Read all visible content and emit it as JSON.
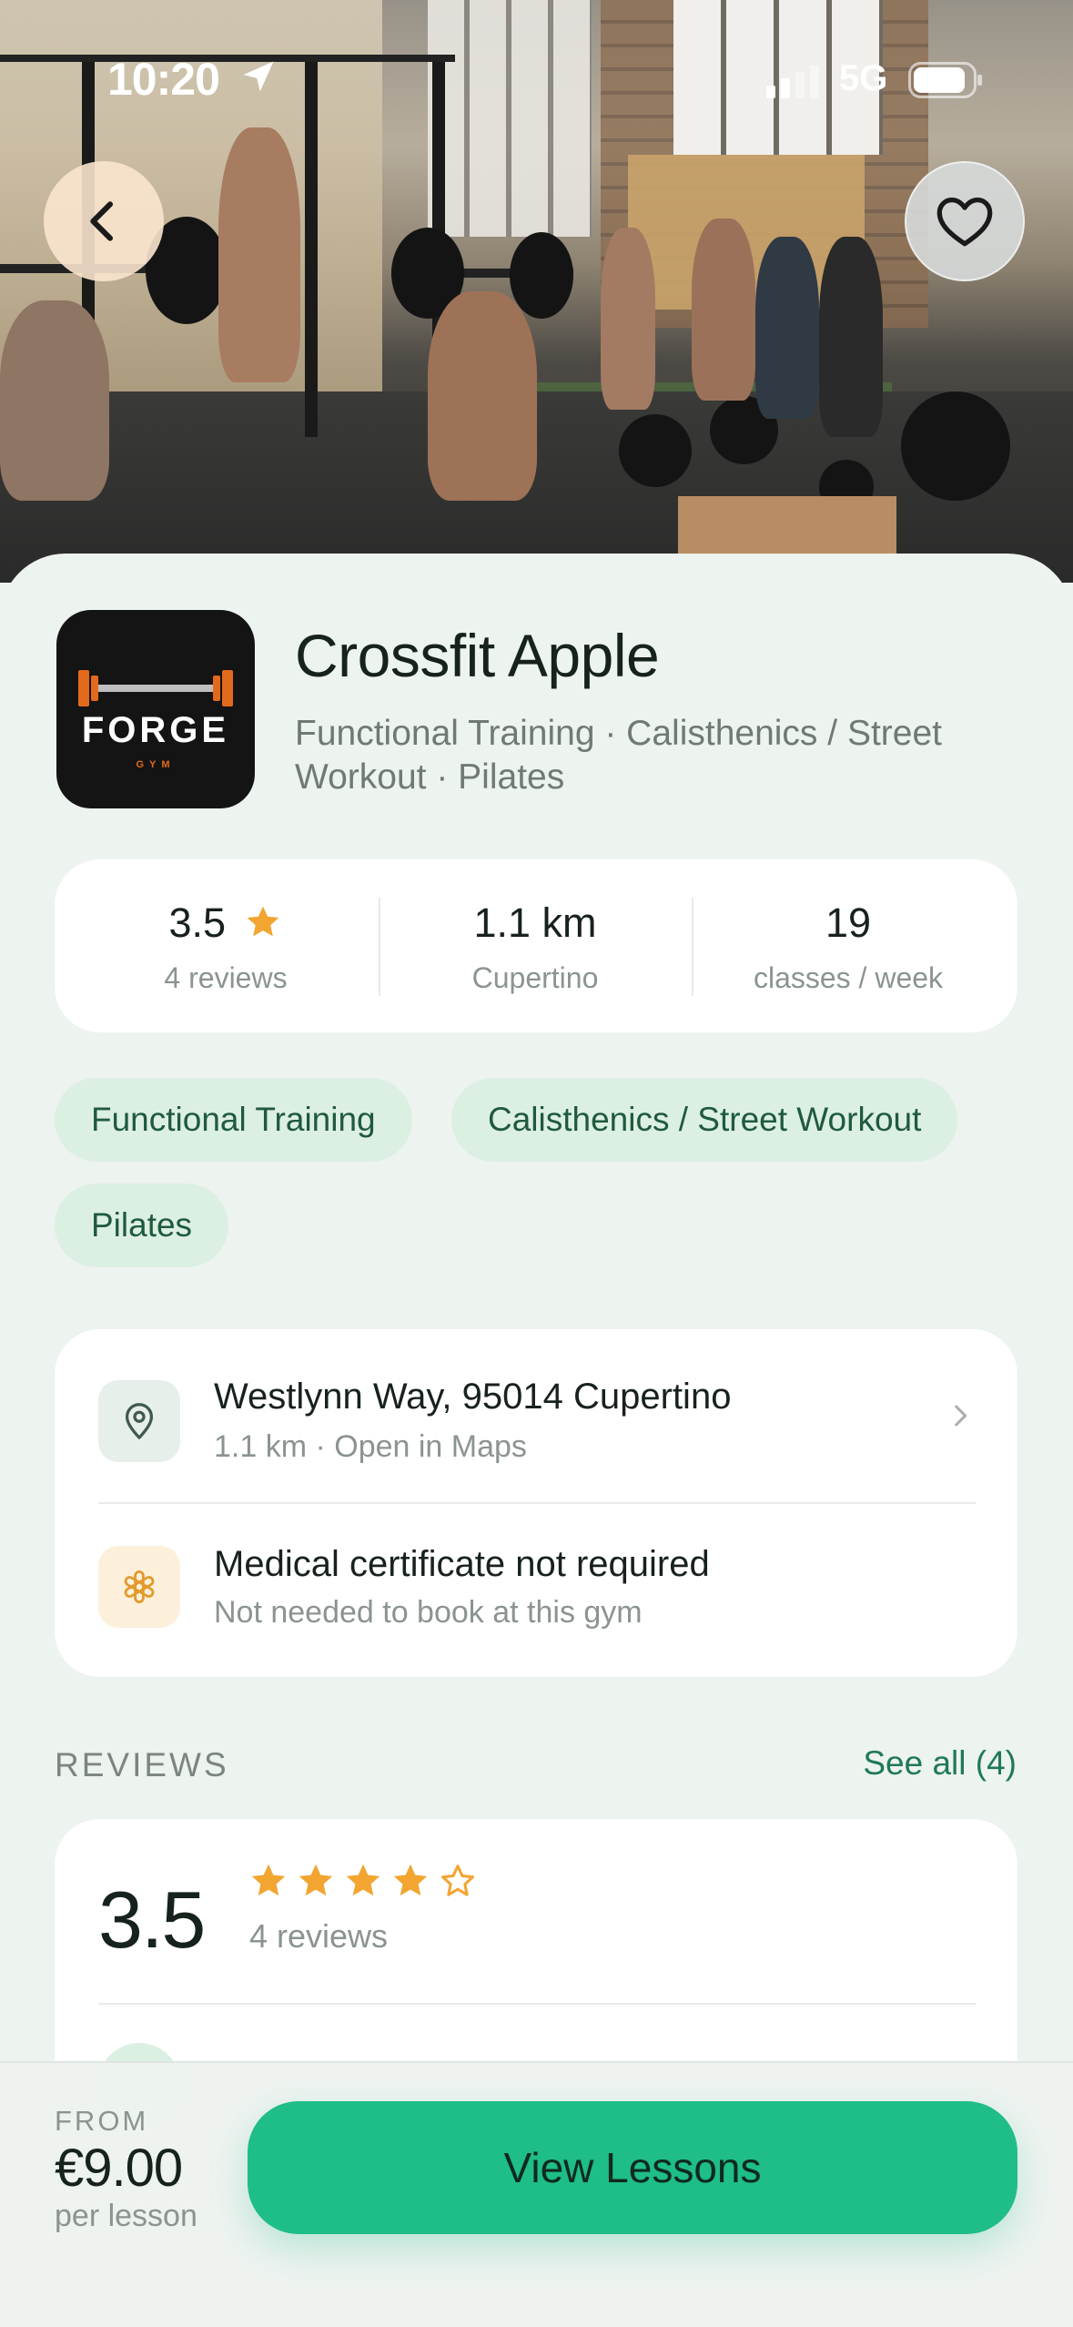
{
  "status_bar": {
    "time": "10:20",
    "network": "5G"
  },
  "gym": {
    "name": "Crossfit Apple",
    "categories_line": "Functional Training · Calisthenics / Street Workout · Pilates",
    "logo_text": "FORGE",
    "logo_subtext": "GYM"
  },
  "stats": {
    "rating_value": "3.5",
    "rating_label": "4 reviews",
    "distance_value": "1.1 km",
    "distance_label": "Cupertino",
    "classes_value": "19",
    "classes_label": "classes / week"
  },
  "tags": [
    "Functional Training",
    "Calisthenics / Street Workout",
    "Pilates"
  ],
  "info": {
    "address_title": "Westlynn Way, 95014 Cupertino",
    "address_sub": "1.1 km · Open in Maps",
    "medical_title": "Medical certificate not required",
    "medical_sub": "Not needed to book at this gym"
  },
  "reviews": {
    "heading": "REVIEWS",
    "see_all": "See all (4)",
    "average": "3.5",
    "count_label": "4 reviews",
    "stars_filled": 4,
    "stars_total": 5
  },
  "footer": {
    "from_label": "FROM",
    "price": "€9.00",
    "per_label": "per lesson",
    "cta_label": "View Lessons"
  },
  "colors": {
    "accent": "#1fbd87",
    "star": "#f2a531",
    "chip_bg": "#dcefe3",
    "chip_text": "#1f5a3e",
    "link": "#1f7a55"
  },
  "icons": {
    "back": "chevron-left-icon",
    "favorite": "heart-icon",
    "location": "map-pin-icon",
    "medical": "asterisk-icon",
    "chevron": "chevron-right-icon",
    "star": "star-icon"
  }
}
